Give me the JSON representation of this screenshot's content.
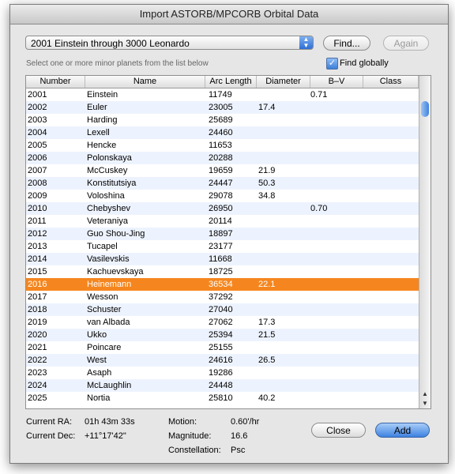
{
  "window": {
    "title": "Import ASTORB/MPCORB Orbital Data"
  },
  "range_popup": {
    "selected": "2001 Einstein through 3000 Leonardo"
  },
  "buttons": {
    "find": "Find...",
    "again": "Again",
    "close": "Close",
    "add": "Add"
  },
  "hint": "Select one or more minor planets from the list below",
  "find_globally": {
    "label": "Find globally",
    "checked": true
  },
  "table": {
    "columns": [
      "Number",
      "Name",
      "Arc Length",
      "Diameter",
      "B–V",
      "Class"
    ],
    "rows": [
      [
        "2001",
        "Einstein",
        "11749",
        "",
        "0.71",
        ""
      ],
      [
        "2002",
        "Euler",
        "23005",
        "17.4",
        "",
        ""
      ],
      [
        "2003",
        "Harding",
        "25689",
        "",
        "",
        ""
      ],
      [
        "2004",
        "Lexell",
        "24460",
        "",
        "",
        ""
      ],
      [
        "2005",
        "Hencke",
        "11653",
        "",
        "",
        ""
      ],
      [
        "2006",
        "Polonskaya",
        "20288",
        "",
        "",
        ""
      ],
      [
        "2007",
        "McCuskey",
        "19659",
        "21.9",
        "",
        ""
      ],
      [
        "2008",
        "Konstitutsiya",
        "24447",
        "50.3",
        "",
        ""
      ],
      [
        "2009",
        "Voloshina",
        "29078",
        "34.8",
        "",
        ""
      ],
      [
        "2010",
        "Chebyshev",
        "26950",
        "",
        "0.70",
        ""
      ],
      [
        "2011",
        "Veteraniya",
        "20114",
        "",
        "",
        ""
      ],
      [
        "2012",
        "Guo Shou-Jing",
        "18897",
        "",
        "",
        ""
      ],
      [
        "2013",
        "Tucapel",
        "23177",
        "",
        "",
        ""
      ],
      [
        "2014",
        "Vasilevskis",
        "11668",
        "",
        "",
        ""
      ],
      [
        "2015",
        "Kachuevskaya",
        "18725",
        "",
        "",
        ""
      ],
      [
        "2016",
        "Heinemann",
        "36534",
        "22.1",
        "",
        ""
      ],
      [
        "2017",
        "Wesson",
        "37292",
        "",
        "",
        ""
      ],
      [
        "2018",
        "Schuster",
        "27040",
        "",
        "",
        ""
      ],
      [
        "2019",
        "van Albada",
        "27062",
        "17.3",
        "",
        ""
      ],
      [
        "2020",
        "Ukko",
        "25394",
        "21.5",
        "",
        ""
      ],
      [
        "2021",
        "Poincare",
        "25155",
        "",
        "",
        ""
      ],
      [
        "2022",
        "West",
        "24616",
        "26.5",
        "",
        ""
      ],
      [
        "2023",
        "Asaph",
        "19286",
        "",
        "",
        ""
      ],
      [
        "2024",
        "McLaughlin",
        "24448",
        "",
        "",
        ""
      ],
      [
        "2025",
        "Nortia",
        "25810",
        "40.2",
        "",
        ""
      ]
    ],
    "selected_row": "2016"
  },
  "info": {
    "ra_label": "Current RA:",
    "ra_value": "01h 43m 33s",
    "dec_label": "Current Dec:",
    "dec_value": "+11°17'42\"",
    "motion_label": "Motion:",
    "motion_value": "0.60'/hr",
    "magnitude_label": "Magnitude:",
    "magnitude_value": "16.6",
    "constellation_label": "Constellation:",
    "constellation_value": "Psc"
  },
  "colors": {
    "selection": "#f5861f",
    "accent": "#3d82e0"
  }
}
